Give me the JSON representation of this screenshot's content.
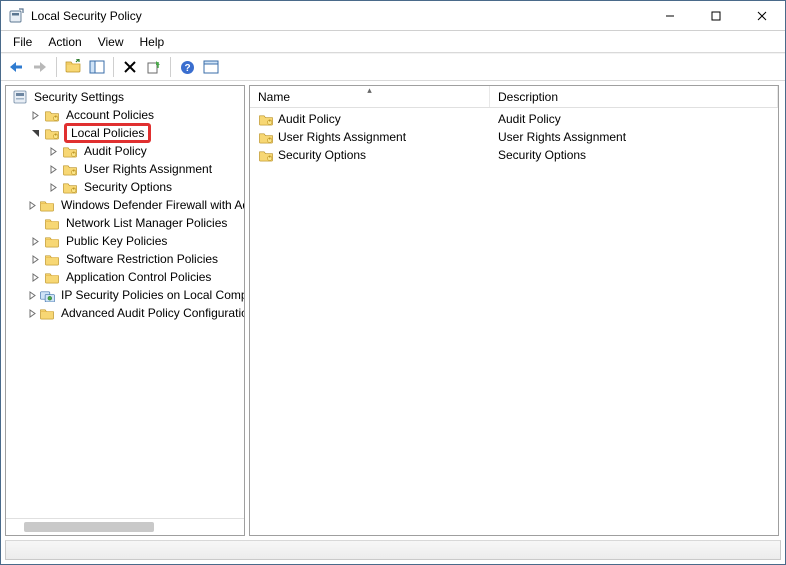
{
  "window": {
    "title": "Local Security Policy"
  },
  "menu": {
    "file": "File",
    "action": "Action",
    "view": "View",
    "help": "Help"
  },
  "tree": {
    "root": "Security Settings",
    "items": [
      {
        "label": "Account Policies",
        "level": 2,
        "exp": "closed",
        "icon": "folder-lock"
      },
      {
        "label": "Local Policies",
        "level": 2,
        "exp": "open",
        "icon": "folder-lock",
        "selected": true,
        "highlighted": true
      },
      {
        "label": "Audit Policy",
        "level": 3,
        "exp": "closed",
        "icon": "folder-lock"
      },
      {
        "label": "User Rights Assignment",
        "level": 3,
        "exp": "closed",
        "icon": "folder-lock"
      },
      {
        "label": "Security Options",
        "level": 3,
        "exp": "closed",
        "icon": "folder-lock"
      },
      {
        "label": "Windows Defender Firewall with Advanced Security",
        "level": 2,
        "exp": "closed",
        "icon": "folder"
      },
      {
        "label": "Network List Manager Policies",
        "level": 2,
        "exp": "none",
        "icon": "folder"
      },
      {
        "label": "Public Key Policies",
        "level": 2,
        "exp": "closed",
        "icon": "folder"
      },
      {
        "label": "Software Restriction Policies",
        "level": 2,
        "exp": "closed",
        "icon": "folder"
      },
      {
        "label": "Application Control Policies",
        "level": 2,
        "exp": "closed",
        "icon": "folder"
      },
      {
        "label": "IP Security Policies on Local Computer",
        "level": 2,
        "exp": "closed",
        "icon": "ipsec"
      },
      {
        "label": "Advanced Audit Policy Configuration",
        "level": 2,
        "exp": "closed",
        "icon": "folder"
      }
    ]
  },
  "list": {
    "columns": {
      "name": "Name",
      "desc": "Description"
    },
    "rows": [
      {
        "name": "Audit Policy",
        "desc": "Audit Policy"
      },
      {
        "name": "User Rights Assignment",
        "desc": "User Rights Assignment"
      },
      {
        "name": "Security Options",
        "desc": "Security Options"
      }
    ]
  }
}
